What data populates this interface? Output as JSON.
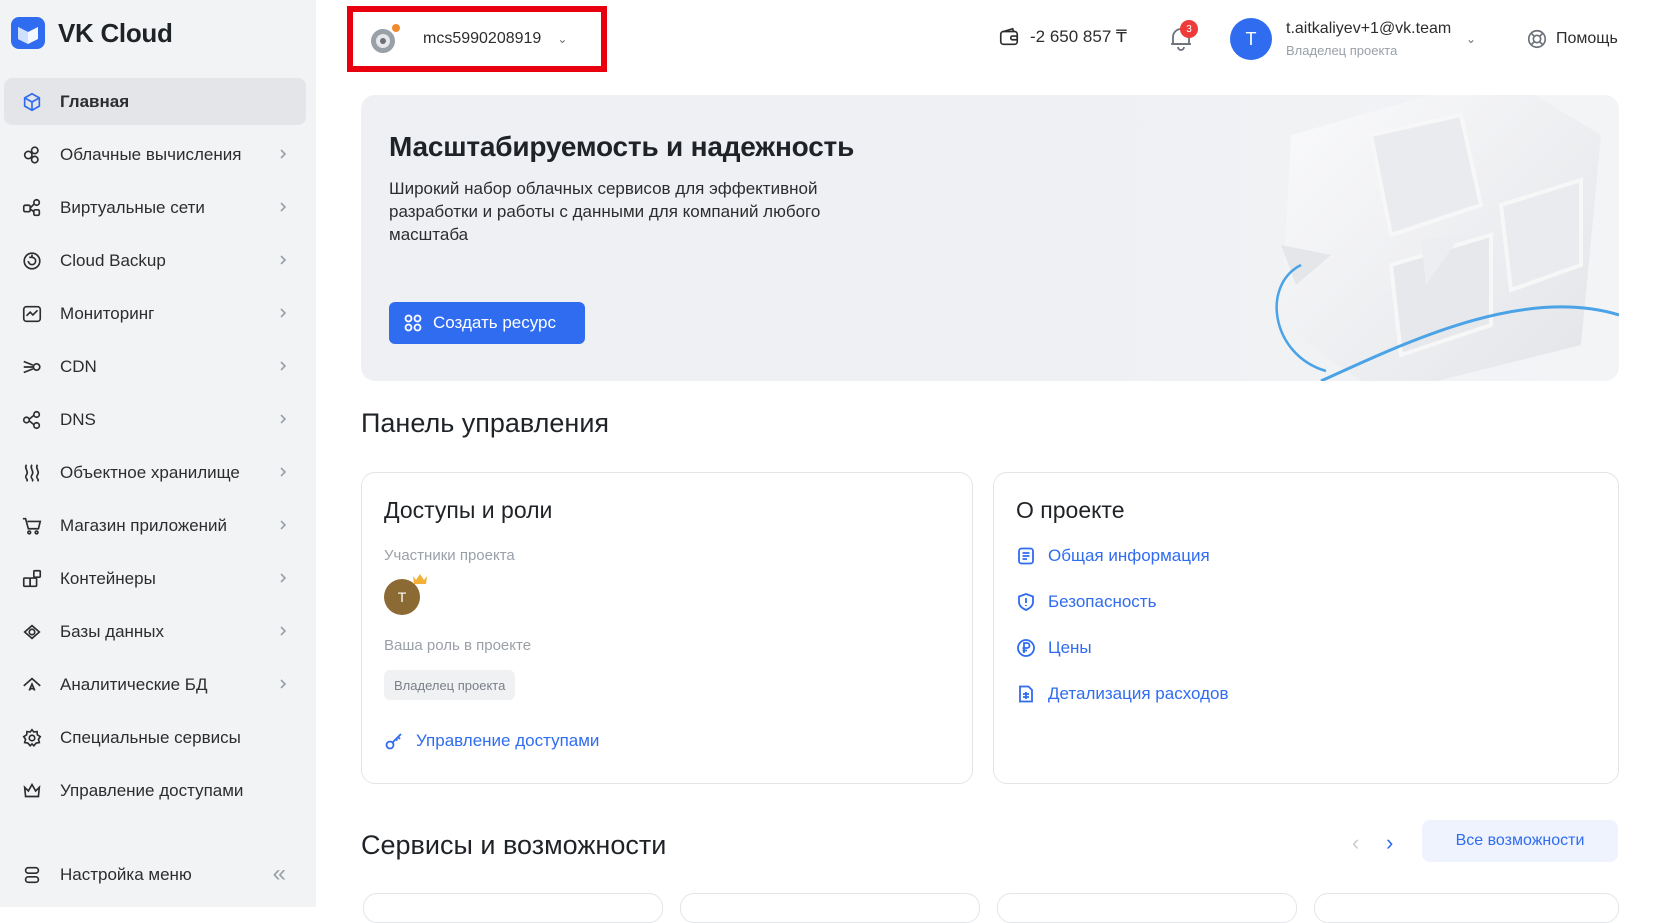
{
  "brand": {
    "name": "VK Cloud",
    "accent": "#2f6cf0"
  },
  "sidebar": {
    "items": [
      {
        "label": "Главная",
        "icon": "cube-icon",
        "active": true
      },
      {
        "label": "Облачные вычисления",
        "icon": "compute-icon"
      },
      {
        "label": "Виртуальные сети",
        "icon": "network-icon"
      },
      {
        "label": "Cloud Backup",
        "icon": "backup-icon"
      },
      {
        "label": "Мониторинг",
        "icon": "monitoring-icon"
      },
      {
        "label": "CDN",
        "icon": "cdn-icon"
      },
      {
        "label": "DNS",
        "icon": "dns-icon"
      },
      {
        "label": "Объектное хранилище",
        "icon": "storage-icon"
      },
      {
        "label": "Магазин приложений",
        "icon": "cart-icon"
      },
      {
        "label": "Контейнеры",
        "icon": "containers-icon"
      },
      {
        "label": "Базы данных",
        "icon": "database-icon"
      },
      {
        "label": "Аналитические БД",
        "icon": "analytics-db-icon"
      },
      {
        "label": "Специальные сервисы",
        "icon": "gear-icon"
      },
      {
        "label": "Управление доступами",
        "icon": "crown-icon"
      }
    ],
    "settings_label": "Настройка меню"
  },
  "topbar": {
    "project_name": "mcs5990208919",
    "balance": "-2 650 857 ₸",
    "notifications_count": "3",
    "user_initial": "T",
    "user_email": "t.aitkaliyev+1@vk.team",
    "user_role": "Владелец проекта",
    "help_label": "Помощь"
  },
  "hero": {
    "title": "Масштабируемость и надежность",
    "description": "Широкий набор облачных сервисов для эффективной разработки и работы с данными для компаний любого масштаба",
    "button_label": "Создать ресурс"
  },
  "dashboard": {
    "title": "Панель управления",
    "access": {
      "title": "Доступы и роли",
      "members_label": "Участники проекта",
      "member_initial": "T",
      "role_label": "Ваша роль в проекте",
      "role_value": "Владелец проекта",
      "manage_link": "Управление доступами"
    },
    "project": {
      "title": "О проекте",
      "links": [
        "Общая информация",
        "Безопасность",
        "Цены",
        "Детализация расходов"
      ]
    }
  },
  "services": {
    "title": "Сервисы и возможности",
    "all_button": "Все возможности"
  }
}
